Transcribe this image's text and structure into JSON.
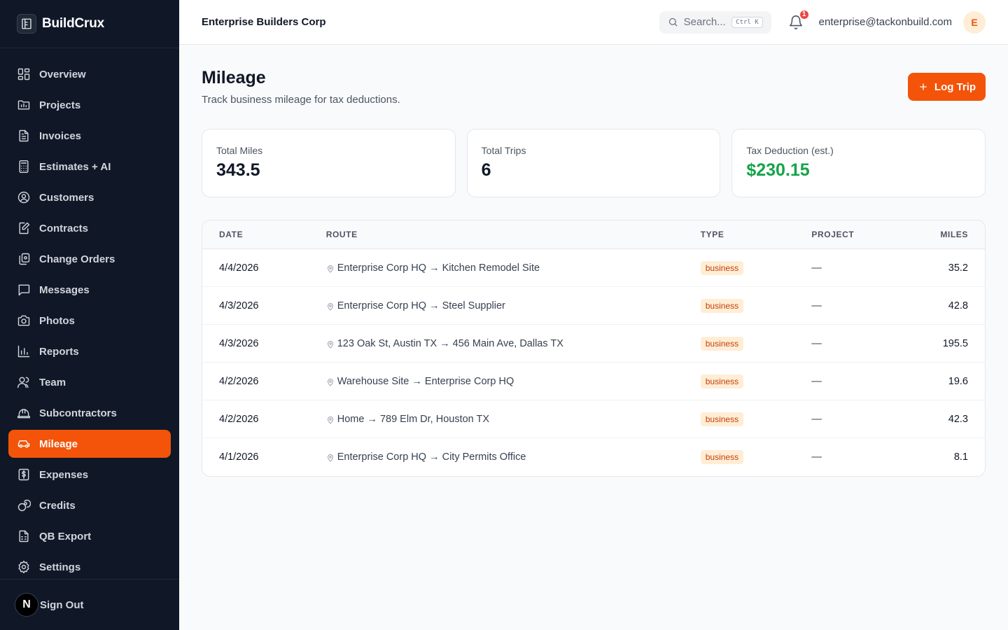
{
  "brand": {
    "name": "BuildCrux"
  },
  "sidebar": {
    "items": [
      {
        "label": "Overview",
        "icon": "grid-icon"
      },
      {
        "label": "Projects",
        "icon": "folder-icon"
      },
      {
        "label": "Invoices",
        "icon": "file-text-icon"
      },
      {
        "label": "Estimates + AI",
        "icon": "calculator-icon"
      },
      {
        "label": "Customers",
        "icon": "user-circle-icon"
      },
      {
        "label": "Contracts",
        "icon": "contract-icon"
      },
      {
        "label": "Change Orders",
        "icon": "copy-icon"
      },
      {
        "label": "Messages",
        "icon": "message-icon"
      },
      {
        "label": "Photos",
        "icon": "camera-icon"
      },
      {
        "label": "Reports",
        "icon": "bar-chart-icon"
      },
      {
        "label": "Team",
        "icon": "users-icon"
      },
      {
        "label": "Subcontractors",
        "icon": "hard-hat-icon"
      },
      {
        "label": "Mileage",
        "icon": "car-icon"
      },
      {
        "label": "Expenses",
        "icon": "receipt-dollar-icon"
      },
      {
        "label": "Credits",
        "icon": "coins-icon"
      },
      {
        "label": "QB Export",
        "icon": "file-spreadsheet-icon"
      },
      {
        "label": "Settings",
        "icon": "gear-icon"
      }
    ],
    "active": "Mileage",
    "footer": {
      "badge": "N",
      "signout_label": "Sign Out"
    }
  },
  "header": {
    "company": "Enterprise Builders Corp",
    "search_placeholder": "Search...",
    "search_shortcut": "Ctrl K",
    "notification_count": "1",
    "email": "enterprise@tackonbuild.com",
    "avatar_initial": "E"
  },
  "page": {
    "title": "Mileage",
    "subtitle": "Track business mileage for tax deductions.",
    "log_button": "Log Trip"
  },
  "stats": [
    {
      "label": "Total Miles",
      "value": "343.5"
    },
    {
      "label": "Total Trips",
      "value": "6"
    },
    {
      "label": "Tax Deduction (est.)",
      "value": "$230.15"
    }
  ],
  "table": {
    "headers": [
      "DATE",
      "ROUTE",
      "TYPE",
      "PROJECT",
      "MILES"
    ],
    "rows": [
      {
        "date": "4/4/2026",
        "route": "Enterprise Corp HQ → Kitchen Remodel Site",
        "type": "business",
        "project": "—",
        "miles": "35.2"
      },
      {
        "date": "4/3/2026",
        "route": "Enterprise Corp HQ → Steel Supplier",
        "type": "business",
        "project": "—",
        "miles": "42.8"
      },
      {
        "date": "4/3/2026",
        "route": "123 Oak St, Austin TX → 456 Main Ave, Dallas TX",
        "type": "business",
        "project": "—",
        "miles": "195.5"
      },
      {
        "date": "4/2/2026",
        "route": "Warehouse Site → Enterprise Corp HQ",
        "type": "business",
        "project": "—",
        "miles": "19.6"
      },
      {
        "date": "4/2/2026",
        "route": "Home → 789 Elm Dr, Houston TX",
        "type": "business",
        "project": "—",
        "miles": "42.3"
      },
      {
        "date": "4/1/2026",
        "route": "Enterprise Corp HQ → City Permits Office",
        "type": "business",
        "project": "—",
        "miles": "8.1"
      }
    ]
  },
  "colors": {
    "accent": "#f35409",
    "sidebar_bg": "#101828",
    "positive": "#16a34a",
    "badge_bg": "#ffedd5",
    "badge_text": "#c2410c"
  }
}
